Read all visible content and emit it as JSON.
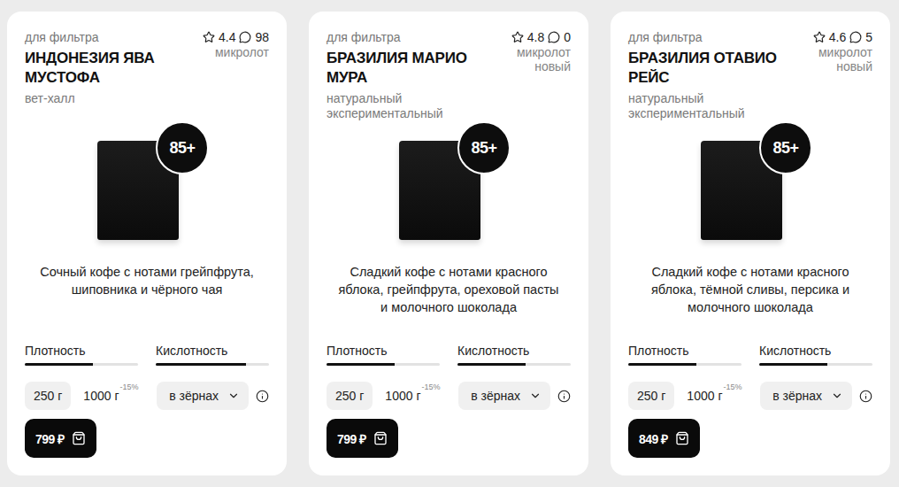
{
  "products": [
    {
      "category": "для фильтра",
      "rating": "4.4",
      "reviews": "98",
      "name": "ИНДОНЕЗИЯ ЯВА МУСТОФА",
      "tags": [
        "микролот"
      ],
      "process": "вет-халл",
      "badge": "85+",
      "description": "Сочный кофе с нотами грейпфрута, шиповника и чёрного чая",
      "meters": [
        {
          "label": "Плотность",
          "level": 0.6
        },
        {
          "label": "Кислотность",
          "level": 0.8
        }
      ],
      "weights": [
        {
          "label": "250 г",
          "selected": true
        },
        {
          "label": "1000 г",
          "discount": "-15%",
          "selected": false
        }
      ],
      "grind": "в зёрнах",
      "price": "799 ₽"
    },
    {
      "category": "для фильтра",
      "rating": "4.8",
      "reviews": "0",
      "name": "БРАЗИЛИЯ МАРИО МУРА",
      "tags": [
        "микролот",
        "новый"
      ],
      "process": "натуральный экспериментальный",
      "badge": "85+",
      "description": "Сладкий кофе с нотами красного яблока, грейпфрута, ореховой пасты и молочного шоколада",
      "meters": [
        {
          "label": "Плотность",
          "level": 0.6
        },
        {
          "label": "Кислотность",
          "level": 0.6
        }
      ],
      "weights": [
        {
          "label": "250 г",
          "selected": true
        },
        {
          "label": "1000 г",
          "discount": "-15%",
          "selected": false
        }
      ],
      "grind": "в зёрнах",
      "price": "799 ₽"
    },
    {
      "category": "для фильтра",
      "rating": "4.6",
      "reviews": "5",
      "name": "БРАЗИЛИЯ ОТАВИО РЕЙС",
      "tags": [
        "микролот",
        "новый"
      ],
      "process": "натуральный экспериментальный",
      "badge": "85+",
      "description": "Сладкий кофе с нотами красного яблока, тёмной сливы, персика и молочного шоколада",
      "meters": [
        {
          "label": "Плотность",
          "level": 0.6
        },
        {
          "label": "Кислотность",
          "level": 0.6
        }
      ],
      "weights": [
        {
          "label": "250 г",
          "selected": true
        },
        {
          "label": "1000 г",
          "discount": "-15%",
          "selected": false
        }
      ],
      "grind": "в зёрнах",
      "price": "849 ₽"
    }
  ]
}
